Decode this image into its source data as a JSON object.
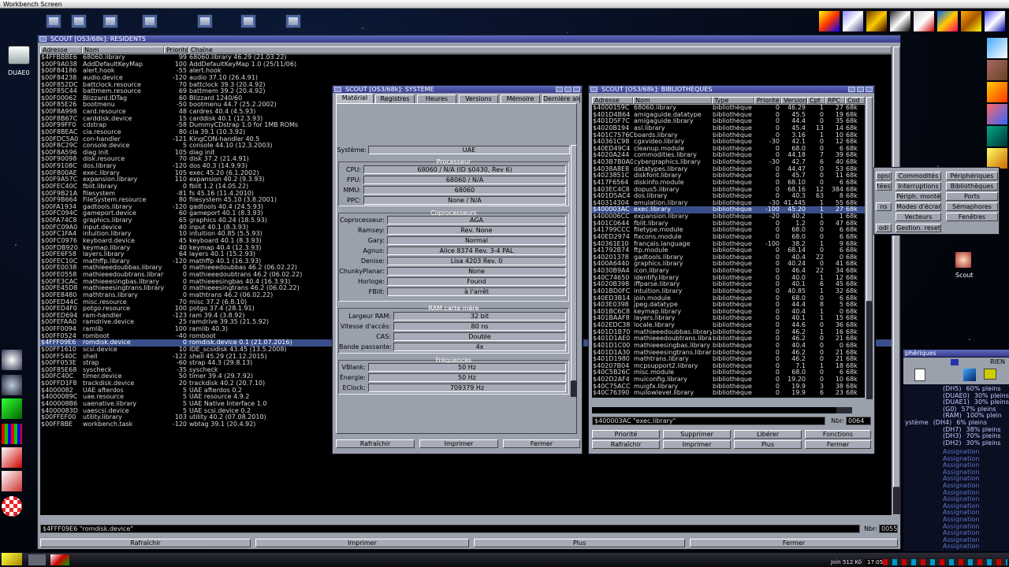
{
  "screen": {
    "title": "Workbench Screen"
  },
  "desktop": {
    "drive_label": "DUAE0",
    "scout_label": "Scout"
  },
  "resident": {
    "title": "SCOUT [OS3/68k]: RÉSIDENTS",
    "columns": [
      "Adresse",
      "Nom",
      "Priorité",
      "Chaîne"
    ],
    "rows": [
      [
        "$4FFBBBE6",
        "68060.library",
        "99",
        "68060.library 46.29 (21.03.22)"
      ],
      [
        "$00F9A038",
        "AddDefaultKeyMap",
        "100",
        "AddDefaultKeyMap 1.0 (25/11/06)"
      ],
      [
        "$00F84186",
        "alert.hook",
        "-55",
        "alert.hook"
      ],
      [
        "$00F84238",
        "audio.device",
        "-120",
        "audio 37.10 (26.4.91)"
      ],
      [
        "$00F852DC",
        "battclock.resource",
        "70",
        "battclock 39.3 (20.4.92)"
      ],
      [
        "$00F85C44",
        "battmem.resource",
        "69",
        "battmem 39.2 (20.4.92)"
      ],
      [
        "$00F00062",
        "Blizzard.IDTag",
        "60",
        "Blizzard 1240/60"
      ],
      [
        "$00F85E26",
        "bootmenu",
        "-50",
        "bootmenu 44.7 (25.2.2002)"
      ],
      [
        "$00F8A998",
        "card.resource",
        "48",
        "cardres 40.4 (4.5.93)"
      ],
      [
        "$00F8B67C",
        "carddisk.device",
        "15",
        "carddisk 40.1 (12.3.93)"
      ],
      [
        "$00F99FF0",
        "cdstrap",
        "-58",
        "DummyCDstrap 1.0 for 1MB ROMs"
      ],
      [
        "$00F8BEAC",
        "cia.resource",
        "80",
        "cia 39.1 (10.3.92)"
      ],
      [
        "$00FDC5A0",
        "con-handler",
        "-121",
        "KingCON-handler 40.5"
      ],
      [
        "$00F8C29C",
        "console.device",
        "5",
        "console 44.10 (12.3.2003)"
      ],
      [
        "$00F8A596",
        "diag init",
        "105",
        "diag init"
      ],
      [
        "$00F90098",
        "disk.resource",
        "70",
        "disk 37.2 (21.4.91)"
      ],
      [
        "$00F9108C",
        "dos.library",
        "-120",
        "dos 40.3 (14.9.93)"
      ],
      [
        "$00F800AE",
        "exec.library",
        "105",
        "exec 45.20 (6.1.2002)"
      ],
      [
        "$00F9A57C",
        "expansion.library",
        "110",
        "expansion 40.2 (9.3.93)"
      ],
      [
        "$00FEC40C",
        "fblit.library",
        "0",
        "fblit 1.2 (14.05.22)"
      ],
      [
        "$00F9B21A",
        "filesystem",
        "-81",
        "fs 45.16 (11.4.2010)"
      ],
      [
        "$00F9B664",
        "FileSystem.resource",
        "80",
        "filesystem 45.10 (3.8.2001)"
      ],
      [
        "$00FA1934",
        "gadtools.library",
        "-120",
        "gadtools 40.4 (24.5.93)"
      ],
      [
        "$00FC094C",
        "gameport.device",
        "60",
        "gameport 40.1 (8.3.93)"
      ],
      [
        "$00FA74C8",
        "graphics.library",
        "65",
        "graphics 40.24 (18.5.93)"
      ],
      [
        "$00FC09A0",
        "input.device",
        "40",
        "input 40.1 (8.3.93)"
      ],
      [
        "$00FC1FA4",
        "intuition.library",
        "10",
        "intuition 40.85 (5.5.93)"
      ],
      [
        "$00FC0976",
        "keyboard.device",
        "45",
        "keyboard 40.1 (8.3.93)"
      ],
      [
        "$00FDB920",
        "keymap.library",
        "40",
        "keymap 40.4 (12.3.93)"
      ],
      [
        "$00FE6F58",
        "layers.library",
        "64",
        "layers 40.1 (15.2.93)"
      ],
      [
        "$00FEC10C",
        "mathffp.library",
        "-120",
        "mathffp 40.1 (16.3.93)"
      ],
      [
        "$00FE0038",
        "mathieeedoubbas.library",
        "0",
        "mathieeedoubbas 46.2 (06.02.22)"
      ],
      [
        "$00FE0558",
        "mathieeedoubtrans.library",
        "0",
        "mathieeedoubtrans 46.2 (06.02.22)"
      ],
      [
        "$00FE3CAC",
        "mathieeesingbas.library",
        "0",
        "mathieeesingbas 40.4 (16.3.93)"
      ],
      [
        "$00FE45D8",
        "mathieeesingtrans.library",
        "0",
        "mathieeesingtrans 46.2 (06.02.22)"
      ],
      [
        "$00FE8480",
        "mathtrans.library",
        "0",
        "mathtrans 46.2 (06.02.22)"
      ],
      [
        "$00FED44C",
        "misc.resource",
        "70",
        "misc 37.2 (6.8.10)"
      ],
      [
        "$00FED4F0",
        "potgo.resource",
        "100",
        "potgo 37.4 (28.1.91)"
      ],
      [
        "$00FED694",
        "ram-handler",
        "-123",
        "ram 39.4 (3.8.92)"
      ],
      [
        "$00FEFAA0",
        "ramdrive.device",
        "25",
        "ramdrive 39.35 (21.5.92)"
      ],
      [
        "$00FF0094",
        "ramlib",
        "100",
        "ramlib 40.3)"
      ],
      [
        "$00FF0524",
        "romboot",
        "-40",
        "romboot"
      ],
      [
        "$4FFF09E6",
        "romdisk.device",
        "0",
        "romdisk.device 0.1 (21.07.2016)"
      ],
      [
        "$00FF1610",
        "scsi.device",
        "10",
        "IDE_scsidisk 43.45 (13.5.2008)"
      ],
      [
        "$00FF540C",
        "shell",
        "-122",
        "shell 45.29 (21.12.2015)"
      ],
      [
        "$00FF053E",
        "strap",
        "-60",
        "strap 44.3 (29.8.13)"
      ],
      [
        "$00F85E68",
        "syscheck",
        "-35",
        "syscheck"
      ],
      [
        "$00FC40C",
        "timer.device",
        "50",
        "timer 39.4 (29.7.92)"
      ],
      [
        "$00FFD1F8",
        "trackdisk.device",
        "20",
        "trackdisk 40.2 (20.7.10)"
      ],
      [
        "$4000082",
        "UAE afterdos",
        "5",
        "UAE afterdos 0.2"
      ],
      [
        "$4000089C",
        "uae.resource",
        "5",
        "UAE resource 4.9.2"
      ],
      [
        "$400008B6",
        "uaenative.library",
        "5",
        "UAE Native Interface 1.0"
      ],
      [
        "$4000083D",
        "uaescsi.device",
        "5",
        "UAE scsi.device 0.2"
      ],
      [
        "$00FFEF00",
        "utility.library",
        "103",
        "utility 40.2 (07.08.2010)"
      ],
      [
        "$00FF8BE",
        "workbench.task",
        "-120",
        "wbtag 39.1 (20.4.92)"
      ]
    ],
    "selected_index": 42,
    "status": "$4FFF09E6 \"romdisk.device\"",
    "nbr_label": "Nbr:",
    "nbr_value": "0055",
    "buttons": [
      "Rafraîchir",
      "Imprimer",
      "Plus",
      "Fermer"
    ]
  },
  "system": {
    "title": "SCOUT [OS3/68k]: SYSTÈME",
    "tabs": [
      "Matériel",
      "Registres",
      "Heures",
      "Versions",
      "Mémoire",
      "Dernière ale"
    ],
    "systeme_label": "Système:",
    "systeme_value": "UAE",
    "processeur_title": "Processeur",
    "proc": [
      [
        "CPU:",
        "68060 / N/A (ID $0430, Rev 6)"
      ],
      [
        "FPU:",
        "68060 / N/A"
      ],
      [
        "MMU:",
        "68060"
      ],
      [
        "PPC:",
        "None / N/A"
      ]
    ],
    "copro_title": "Coprocesseurs",
    "copro": [
      [
        "Coprocesseur:",
        "AGA"
      ],
      [
        "Ramsey:",
        "Rev. None"
      ],
      [
        "Gary:",
        "Normal"
      ],
      [
        "Agnus:",
        "Alice 8374 Rev. 3-4 PAL"
      ],
      [
        "Denise:",
        "Lisa 4203 Rev. 0"
      ],
      [
        "ChunkyPlanar:",
        "None"
      ],
      [
        "Horloge:",
        "Found"
      ],
      [
        "FBlit:",
        "à l'arrêt"
      ]
    ],
    "ram_title": "RAM carte mère",
    "ram": [
      [
        "Largeur RAM:",
        "32 bit"
      ],
      [
        "Vitesse d'accès:",
        "80 ns"
      ],
      [
        "CAS:",
        "Double"
      ],
      [
        "Bande passante:",
        "4x"
      ]
    ],
    "freq_title": "Fréquences",
    "freq": [
      [
        "VBlank:",
        "50 Hz"
      ],
      [
        "Énergie:",
        "50 Hz"
      ],
      [
        "EClock:",
        "709379 Hz"
      ]
    ],
    "buttons": [
      "Rafraîchir",
      "Imprimer",
      "Fermer"
    ]
  },
  "libs": {
    "title": "SCOUT [OS3/68k]: BIBLIOTHÈQUES",
    "columns": [
      "Adresse",
      "Nom",
      "Type",
      "Priorité",
      "Version",
      "Cpt",
      "RPC",
      "Cod"
    ],
    "rows": [
      [
        "$4000159C",
        "68060.library",
        "bibliothèque",
        "0",
        "46.29",
        "1",
        "27",
        "68k"
      ],
      [
        "$401D4B64",
        "amigaguide.datatype",
        "bibliothèque",
        "0",
        "45.5",
        "0",
        "19",
        "68k"
      ],
      [
        "$401D5F7C",
        "amigaguide.library",
        "bibliothèque",
        "0",
        "44.4",
        "0",
        "35",
        "68k"
      ],
      [
        "$4020B194",
        "asl.library",
        "bibliothèque",
        "0",
        "45.4",
        "13",
        "14",
        "68k"
      ],
      [
        "$401C7576C",
        "boards.library",
        "bibliothèque",
        "0",
        "3.16",
        "1",
        "10",
        "68k"
      ],
      [
        "$40361C98",
        "cgxvideo.library",
        "bibliothèque",
        "-30",
        "42.1",
        "0",
        "12",
        "68k"
      ],
      [
        "$40ED49C4",
        "cleanup.module",
        "bibliothèque",
        "0",
        "68.0",
        "0",
        "6",
        "68k"
      ],
      [
        "$4020A244",
        "commodities.library",
        "bibliothèque",
        "0",
        "44.18",
        "7",
        "39",
        "68k"
      ],
      [
        "$403B7B0A0",
        "cybergraphics.library",
        "bibliothèque",
        "-30",
        "42.7",
        "6",
        "40",
        "68k"
      ],
      [
        "$4038A8E8",
        "datatypes.library",
        "bibliothèque",
        "0",
        "44.47",
        "0",
        "53",
        "68k"
      ],
      [
        "$4023851C",
        "diskfont.library",
        "bibliothèque",
        "0",
        "45.7",
        "0",
        "11",
        "68k"
      ],
      [
        "$417F6564",
        "diskinfo.module",
        "bibliothèque",
        "0",
        "68.10",
        "0",
        "6",
        "68k"
      ],
      [
        "$403EC4C8",
        "dopus5.library",
        "bibliothèque",
        "0",
        "68.16",
        "12",
        "384",
        "68k"
      ],
      [
        "$401D5AC4",
        "dos.library",
        "bibliothèque",
        "0",
        "40.3",
        "63",
        "8",
        "68k"
      ],
      [
        "$40314304",
        "emulation.library",
        "bibliothèque",
        "-30",
        "41.445",
        "1",
        "55",
        "68k"
      ],
      [
        "$400003AC",
        "exec.library",
        "bibliothèque",
        "-100",
        "45.20",
        "1",
        "27",
        "68k"
      ],
      [
        "$400006CC",
        "expansion.library",
        "bibliothèque",
        "-20",
        "40.2",
        "1",
        "1",
        "68k"
      ],
      [
        "$401C0644",
        "fblit.library",
        "bibliothèque",
        "0",
        "1.2",
        "0",
        "47",
        "68k"
      ],
      [
        "$41799CCC",
        "filetype.module",
        "bibliothèque",
        "0",
        "68.0",
        "0",
        "6",
        "68k"
      ],
      [
        "$40ED2974",
        "flxcons.module",
        "bibliothèque",
        "0",
        "68.0",
        "0",
        "6",
        "68k"
      ],
      [
        "$40361E10",
        "français.language",
        "bibliothèque",
        "-100",
        "38.2",
        "1",
        "9",
        "68k"
      ],
      [
        "$41792B74",
        "ftp.module",
        "bibliothèque",
        "0",
        "68.14",
        "0",
        "6",
        "68k"
      ],
      [
        "$40201378",
        "gadtools.library",
        "bibliothèque",
        "0",
        "40.4",
        "22",
        "0",
        "68k"
      ],
      [
        "$400A6440",
        "graphics.library",
        "bibliothèque",
        "0",
        "40.24",
        "0",
        "41",
        "68k"
      ],
      [
        "$4030B9A4",
        "icon.library",
        "bibliothèque",
        "0",
        "46.4",
        "22",
        "34",
        "68k"
      ],
      [
        "$40C74650",
        "identify.library",
        "bibliothèque",
        "0",
        "40.0",
        "1",
        "12",
        "68k"
      ],
      [
        "$4020B398",
        "iffparse.library",
        "bibliothèque",
        "0",
        "40.1",
        "6",
        "45",
        "68k"
      ],
      [
        "$401BD0FC",
        "intuition.library",
        "bibliothèque",
        "0",
        "40.85",
        "1",
        "32",
        "68k"
      ],
      [
        "$40ED3B14",
        "join.module",
        "bibliothèque",
        "0",
        "68.0",
        "0",
        "6",
        "68k"
      ],
      [
        "$403E0398",
        "jpeg.datatype",
        "bibliothèque",
        "0",
        "44.4",
        "8",
        "5",
        "68k"
      ],
      [
        "$401BC6C8",
        "keymap.library",
        "bibliothèque",
        "0",
        "40.4",
        "1",
        "0",
        "68k"
      ],
      [
        "$401BAAF8",
        "layers.library",
        "bibliothèque",
        "0",
        "40.1",
        "1",
        "15",
        "68k"
      ],
      [
        "$402EDC38",
        "locale.library",
        "bibliothèque",
        "0",
        "44.6",
        "0",
        "36",
        "68k"
      ],
      [
        "$401D1B70",
        "mathieeedoubbas.library",
        "bibliothèque",
        "0",
        "46.2",
        "1",
        "16",
        "68k"
      ],
      [
        "$401D1AE0",
        "mathieeedoubtrans.library",
        "bibliothèque",
        "0",
        "46.2",
        "0",
        "21",
        "68k"
      ],
      [
        "$401D1C00",
        "mathieeesingbas.library",
        "bibliothèque",
        "0",
        "40.4",
        "0",
        "0",
        "68k"
      ],
      [
        "$401D1A30",
        "mathieeesingtrans.library",
        "bibliothèque",
        "0",
        "46.2",
        "0",
        "21",
        "68k"
      ],
      [
        "$401D1980",
        "mathtrans.library",
        "bibliothèque",
        "0",
        "46.2",
        "0",
        "21",
        "68k"
      ],
      [
        "$40207B04",
        "mcpsupport2.library",
        "bibliothèque",
        "0",
        "7.1",
        "1",
        "18",
        "68k"
      ],
      [
        "$40C5B26C",
        "misc.module",
        "bibliothèque",
        "0",
        "68.0",
        "0",
        "6",
        "68k"
      ],
      [
        "$402D2AF4",
        "muiconfig.library",
        "bibliothèque",
        "0",
        "19.20",
        "0",
        "10",
        "68k"
      ],
      [
        "$40C75ACC",
        "muigfx.library",
        "bibliothèque",
        "0",
        "19.9",
        "3",
        "38",
        "68k"
      ],
      [
        "$40C76390",
        "muilowlevel.library",
        "bibliothèque",
        "0",
        "19.9",
        "6",
        "23",
        "68k"
      ]
    ],
    "selected_index": 15,
    "status": "$400003AC \"exec.library\"",
    "nbr_label": "Nbr:",
    "nbr_value": "0064",
    "buttons": [
      "Priorité",
      "Supprimer",
      "Libérer",
      "Fonctions",
      "Rafraîchir",
      "Imprimer",
      "Plus",
      "Fermer"
    ]
  },
  "main_menu": {
    "left_col": [
      "opsi",
      "tées",
      "ns",
      "odi"
    ],
    "items": [
      "Commodités",
      "Périphériques",
      "Interruptions",
      "Bibliothèques",
      "Périph. montés",
      "Ports",
      "Modes d'écran",
      "Sémaphores",
      "Vecteurs",
      "Fenêtres",
      "Gestion. reset"
    ]
  },
  "device_panel": {
    "title": "phériques",
    "mode": "RIEN",
    "rows": [
      [
        "(DH5)",
        "60% pleins"
      ],
      [
        "(DUAE0)",
        "30% pleins"
      ],
      [
        "(DUAE1)",
        "30% pleins"
      ],
      [
        "(G0)",
        "57% pleins"
      ],
      [
        "(RAM)",
        "100% plein"
      ],
      [
        "ystème",
        "(DH4)",
        "6% pleins"
      ],
      [
        "(DH7)",
        "38% pleins"
      ],
      [
        "(DH3)",
        "70% pleins"
      ],
      [
        "(DH2)",
        "30% pleins"
      ]
    ],
    "assign": "Assignation"
  },
  "taskbar": {
    "mem_label": "Join 512 Kô",
    "clock": "17:05"
  },
  "colors": {
    "title_grad": "#3a3a90",
    "list_bg": "#000000",
    "selection": "#3a4f8a",
    "panel": "#9aa0ac"
  }
}
